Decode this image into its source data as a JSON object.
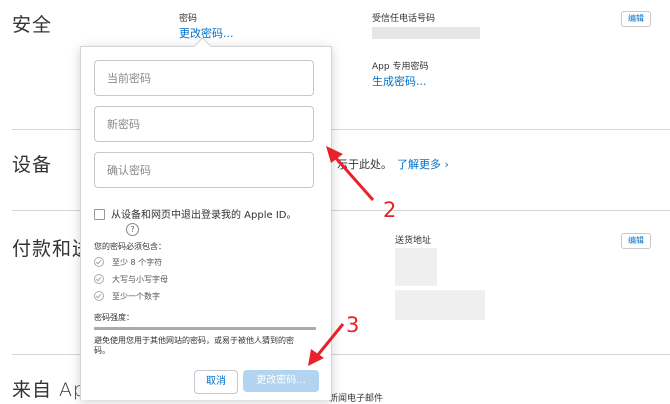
{
  "sections": {
    "security": {
      "title": "安全",
      "password_label": "密码",
      "change_password_link": "更改密码...",
      "trusted_phone_label": "受信任电话号码",
      "app_password_label": "App 专用密码",
      "generate_password_link": "生成密码...",
      "edit_label": "编辑"
    },
    "devices": {
      "title": "设备",
      "text": "示于此处。",
      "learn_more_link": "了解更多 ›"
    },
    "payment": {
      "title": "付款和送",
      "shipping_label": "送货地址",
      "edit_label": "编辑"
    },
    "from_apple": {
      "title": "来自 App",
      "subtitle": "新闻电子邮件"
    }
  },
  "popover": {
    "current_password_placeholder": "当前密码",
    "new_password_placeholder": "新密码",
    "confirm_password_placeholder": "确认密码",
    "signout_checkbox_label": "从设备和网页中退出登录我的 Apple ID。",
    "help_icon_text": "?",
    "requirements_title": "您的密码必须包含：",
    "requirements": [
      "至少 8 个字符",
      "大写与小写字母",
      "至少一个数字"
    ],
    "strength_label": "密码强度：",
    "strength_note": "避免使用您用于其他网站的密码，或易于被他人猜到的密码。",
    "cancel_button": "取消",
    "change_button": "更改密码..."
  },
  "annotations": {
    "marker_2": "2",
    "marker_3": "3",
    "color": "#e8212a"
  }
}
